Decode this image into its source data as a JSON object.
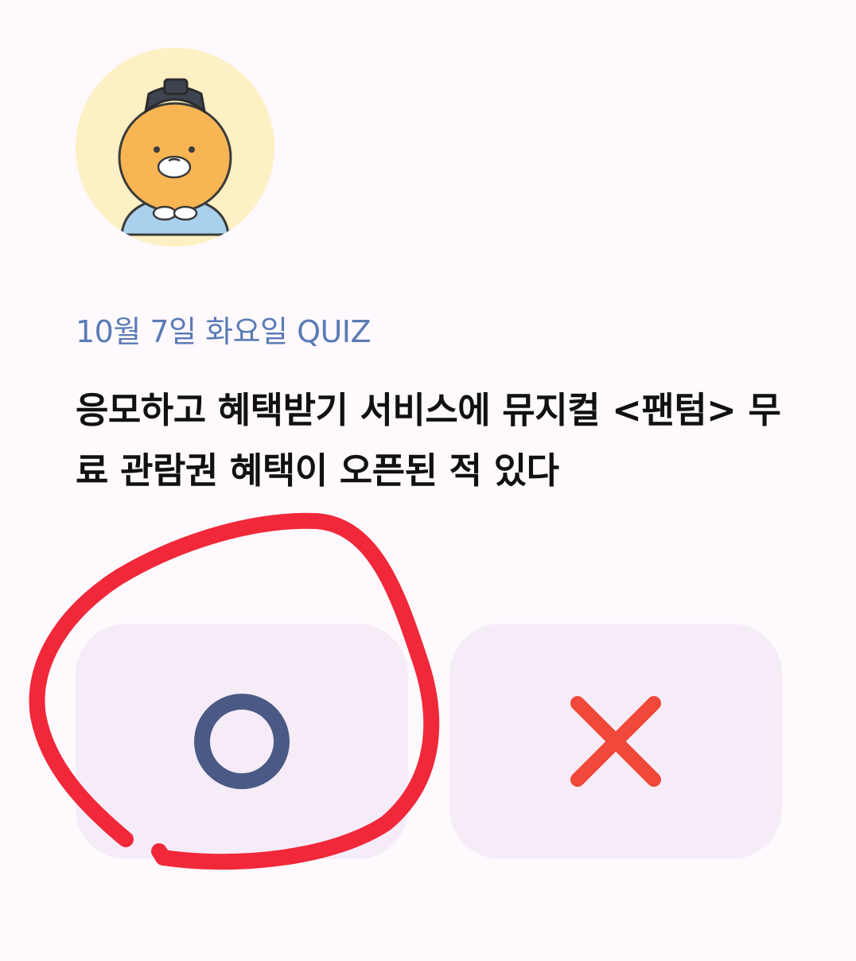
{
  "quiz": {
    "date_label": "10월 7일 화요일 QUIZ",
    "question": "응모하고 혜택받기 서비스에 뮤지컬 <팬텀> 무료 관람권 혜택이 오픈된 적 있다",
    "answers": {
      "o_icon": "circle-o-icon",
      "x_icon": "cross-x-icon"
    }
  },
  "colors": {
    "date_text": "#5a7bb5",
    "question_text": "#111111",
    "button_bg": "#f5ecf8",
    "o_mark": "#4a5a85",
    "x_mark": "#f0483a",
    "annotation": "#f0283a"
  }
}
